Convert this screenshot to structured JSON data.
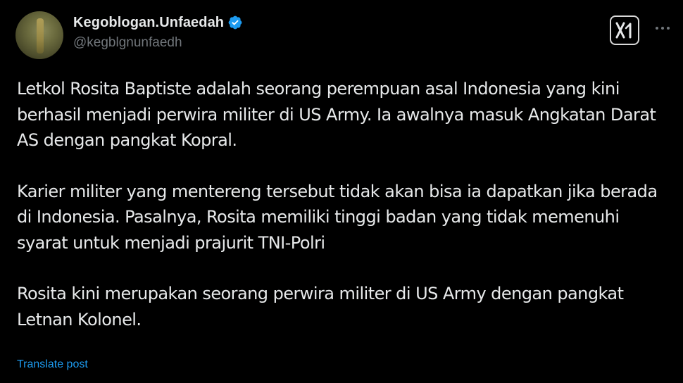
{
  "author": {
    "display_name": "Kegoblogan.Unfaedah",
    "handle": "@kegblgnunfaedh",
    "avatar_icon": "profile-photo",
    "verified_icon": "verified-badge-icon"
  },
  "actions": {
    "grok_icon": "x-ai-icon",
    "more_icon": "more-options-icon"
  },
  "post": {
    "paragraphs": [
      "Letkol Rosita Baptiste adalah seorang perempuan asal Indonesia yang kini berhasil menjadi perwira militer di US Army. Ia awalnya masuk Angkatan Darat AS dengan pangkat Kopral.",
      "Karier militer yang mentereng tersebut tidak akan bisa ia dapatkan jika berada di Indonesia. Pasalnya, Rosita memiliki tinggi badan yang tidak memenuhi syarat untuk menjadi prajurit TNI-Polri",
      "Rosita kini merupakan seorang perwira militer di US Army dengan pangkat Letnan Kolonel."
    ],
    "translate_label": "Translate post"
  },
  "colors": {
    "background": "#000000",
    "text_primary": "#e7e9ea",
    "text_secondary": "#71767b",
    "accent_blue": "#1d9bf0"
  }
}
